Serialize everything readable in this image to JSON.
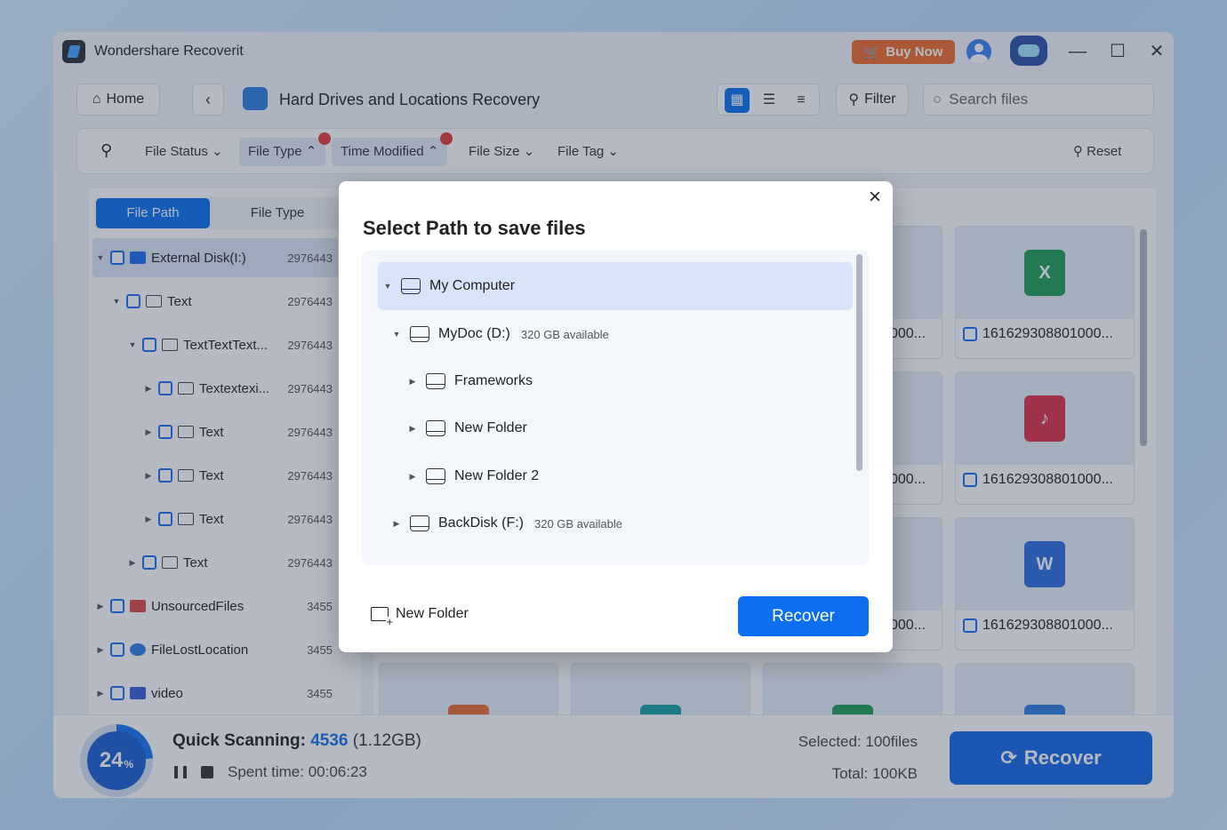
{
  "window": {
    "title": "Wondershare Recoverit",
    "buy_now": "Buy Now"
  },
  "nav": {
    "home": "Home",
    "page_title": "Hard Drives and Locations Recovery",
    "filter": "Filter",
    "search_placeholder": "Search files"
  },
  "filters": {
    "file_status": "File Status",
    "file_type": "File Type",
    "time_modified": "Time Modified",
    "file_size": "File Size",
    "file_tag": "File Tag",
    "reset": "Reset"
  },
  "sidebar": {
    "tabs": [
      "File Path",
      "File Type"
    ],
    "tree": [
      {
        "label": "External Disk(I:)",
        "count": "2976443"
      },
      {
        "label": "Text",
        "count": "2976443"
      },
      {
        "label": "TextTextText...",
        "count": "2976443"
      },
      {
        "label": "Textextexi...",
        "count": "2976443"
      },
      {
        "label": "Text",
        "count": "2976443"
      },
      {
        "label": "Text",
        "count": "2976443"
      },
      {
        "label": "Text",
        "count": "2976443"
      },
      {
        "label": "Text",
        "count": "2976443"
      },
      {
        "label": "UnsourcedFiles",
        "count": "3455"
      },
      {
        "label": "FileLostLocation",
        "count": "3455"
      },
      {
        "label": "video",
        "count": "3455"
      }
    ]
  },
  "grid": {
    "cards": [
      {
        "name": "161629308801000...",
        "icon": "excel-icon"
      },
      {
        "name": "161629308801000...",
        "icon": "music-icon"
      },
      {
        "name": "161629308801000...",
        "icon": "word-icon"
      }
    ],
    "partial_label": "000..."
  },
  "status": {
    "progress": "24",
    "percent_sign": "%",
    "scan_label": "Quick Scanning:",
    "scan_count": "4536",
    "scan_size": "(1.12GB)",
    "spent_time": "Spent time: 00:06:23",
    "selected": "Selected: 100files",
    "total": "Total: 100KB",
    "recover": "Recover"
  },
  "modal": {
    "title": "Select Path to save files",
    "rows": [
      {
        "label": "My Computer",
        "available": ""
      },
      {
        "label": "MyDoc (D:)",
        "available": "320 GB available"
      },
      {
        "label": "Frameworks",
        "available": ""
      },
      {
        "label": "New Folder",
        "available": ""
      },
      {
        "label": "New Folder 2",
        "available": ""
      },
      {
        "label": "BackDisk (F:)",
        "available": "320 GB available"
      }
    ],
    "new_folder": "New Folder",
    "recover": "Recover"
  },
  "colors": {
    "accent": "#0b6ff0",
    "buy_now": "#f26a2c",
    "notification_dot": "#e53935"
  }
}
